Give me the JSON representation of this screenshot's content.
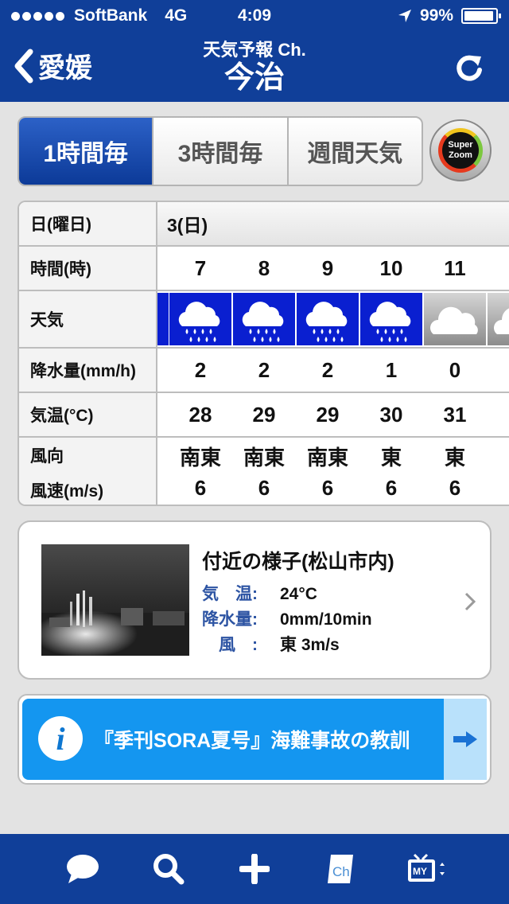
{
  "status_bar": {
    "carrier": "SoftBank",
    "network": "4G",
    "time": "4:09",
    "battery": "99%"
  },
  "nav": {
    "back_label": "愛媛",
    "subtitle": "天気予報 Ch.",
    "title": "今治"
  },
  "segments": [
    "1時間毎",
    "3時間毎",
    "週間天気"
  ],
  "zoom_button": {
    "line1": "Super",
    "line2": "Zoom"
  },
  "forecast": {
    "labels": {
      "day": "日(曜日)",
      "hour": "時間(時)",
      "weather": "天気",
      "precip": "降水量(mm/h)",
      "temp": "気温(°C)",
      "wind_dir": "風向",
      "wind_speed": "風速(m/s)"
    },
    "day_value": "3(日)",
    "hours": [
      "7",
      "8",
      "9",
      "10",
      "11"
    ],
    "weather": [
      "rain",
      "rain",
      "rain",
      "rain",
      "cloudy"
    ],
    "precip": [
      "2",
      "2",
      "2",
      "1",
      "0"
    ],
    "temp": [
      "28",
      "29",
      "29",
      "30",
      "31"
    ],
    "wind_dir": [
      "南東",
      "南東",
      "南東",
      "東",
      "東"
    ],
    "wind_speed": [
      "6",
      "6",
      "6",
      "6",
      "6"
    ]
  },
  "nearby": {
    "title": "付近の様子(松山市内)",
    "temp_label": "気　温:",
    "temp_value": "24°C",
    "precip_label": "降水量:",
    "precip_value": "0mm/10min",
    "wind_label": "　風　:",
    "wind_value": "東 3m/s"
  },
  "banner": {
    "text": "『季刊SORA夏号』海難事故の教訓"
  },
  "tabbar_icons": [
    "chat-bubble-icon",
    "search-icon",
    "plus-icon",
    "channel-icon",
    "my-tv-icon"
  ],
  "colors": {
    "nav": "#103f99",
    "rain_bg": "#0a1fd0",
    "banner": "#1496f0",
    "label_blue": "#2d54a3"
  }
}
